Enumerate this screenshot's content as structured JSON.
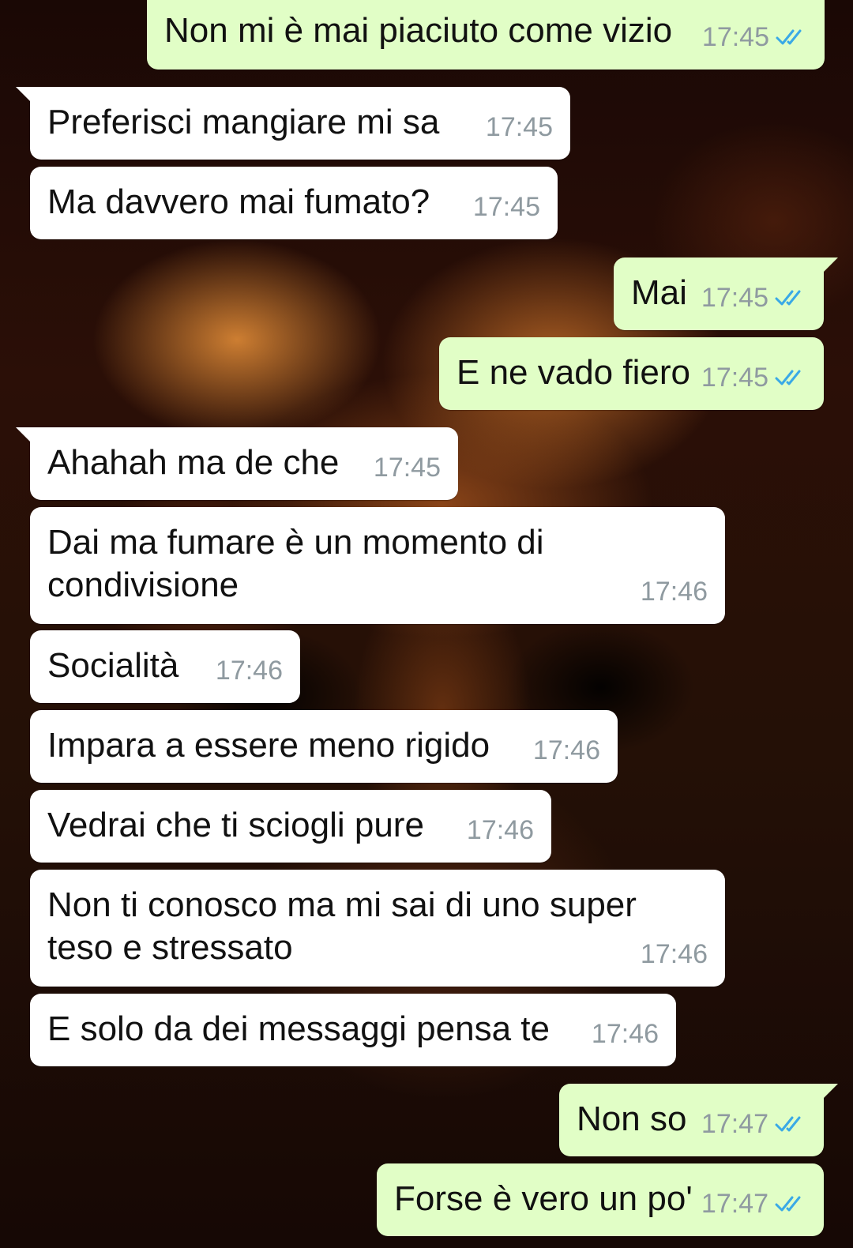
{
  "chat": {
    "read_tick_color": "#3aa9e6",
    "incoming_bubble_color": "#ffffff",
    "outgoing_bubble_color": "#e1fec6",
    "messages": [
      {
        "text": "Non mi è mai piaciuto come vizio",
        "time": "17:45",
        "direction": "out",
        "status_icon": "double-check-icon"
      },
      {
        "text": "Preferisci mangiare mi sa",
        "time": "17:45",
        "direction": "in"
      },
      {
        "text": "Ma davvero mai fumato?",
        "time": "17:45",
        "direction": "in"
      },
      {
        "text": "Mai",
        "time": "17:45",
        "direction": "out",
        "status_icon": "double-check-icon"
      },
      {
        "text": "E ne vado fiero",
        "time": "17:45",
        "direction": "out",
        "status_icon": "double-check-icon"
      },
      {
        "text": "Ahahah ma de che",
        "time": "17:45",
        "direction": "in"
      },
      {
        "text": "Dai ma fumare è un momento di condivisione",
        "time": "17:46",
        "direction": "in"
      },
      {
        "text": "Socialità",
        "time": "17:46",
        "direction": "in"
      },
      {
        "text": "Impara a essere meno rigido",
        "time": "17:46",
        "direction": "in"
      },
      {
        "text": "Vedrai che ti sciogli pure",
        "time": "17:46",
        "direction": "in"
      },
      {
        "text": "Non ti conosco ma mi sai di uno super teso e stressato",
        "time": "17:46",
        "direction": "in"
      },
      {
        "text": "E solo da dei messaggi pensa te",
        "time": "17:46",
        "direction": "in"
      },
      {
        "text": "Non so",
        "time": "17:47",
        "direction": "out",
        "status_icon": "double-check-icon"
      },
      {
        "text": "Forse è vero un po'",
        "time": "17:47",
        "direction": "out",
        "status_icon": "double-check-icon"
      }
    ]
  }
}
